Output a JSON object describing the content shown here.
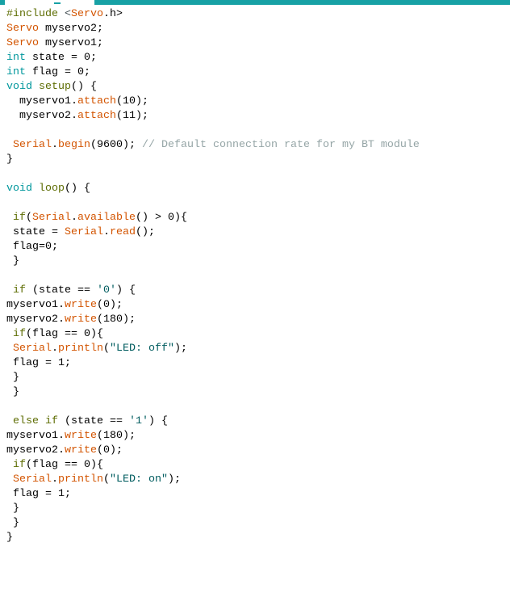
{
  "colors": {
    "tab_bar": "#17A1A5",
    "keyword": "#D35400",
    "type": "#00979C",
    "function": "#5E6D03",
    "string": "#005C5F",
    "comment": "#95A5A6"
  },
  "code": {
    "lines": [
      [
        [
          "#include ",
          "pp"
        ],
        [
          "<",
          "op"
        ],
        [
          "Servo",
          "kw"
        ],
        [
          ".h>",
          "plain"
        ]
      ],
      [
        [
          "Servo",
          "kw"
        ],
        [
          " myservo2;",
          "plain"
        ]
      ],
      [
        [
          "Servo",
          "kw"
        ],
        [
          " myservo1;",
          "plain"
        ]
      ],
      [
        [
          "int",
          "type"
        ],
        [
          " state = 0;",
          "plain"
        ]
      ],
      [
        [
          "int",
          "type"
        ],
        [
          " flag = 0;",
          "plain"
        ]
      ],
      [
        [
          "void",
          "type"
        ],
        [
          " ",
          "plain"
        ],
        [
          "setup",
          "fn"
        ],
        [
          "() {",
          "plain"
        ]
      ],
      [
        [
          "  myservo1.",
          "plain"
        ],
        [
          "attach",
          "kw"
        ],
        [
          "(10);",
          "plain"
        ]
      ],
      [
        [
          "  myservo2.",
          "plain"
        ],
        [
          "attach",
          "kw"
        ],
        [
          "(11);",
          "plain"
        ]
      ],
      [],
      [
        [
          " ",
          "plain"
        ],
        [
          "Serial",
          "kw"
        ],
        [
          ".",
          "plain"
        ],
        [
          "begin",
          "kw"
        ],
        [
          "(9600); ",
          "plain"
        ],
        [
          "// Default connection rate for my BT module",
          "cmt"
        ]
      ],
      [
        [
          "}",
          "plain"
        ]
      ],
      [],
      [
        [
          "void",
          "type"
        ],
        [
          " ",
          "plain"
        ],
        [
          "loop",
          "fn"
        ],
        [
          "() {",
          "plain"
        ]
      ],
      [],
      [
        [
          " ",
          "plain"
        ],
        [
          "if",
          "fn"
        ],
        [
          "(",
          "plain"
        ],
        [
          "Serial",
          "kw"
        ],
        [
          ".",
          "plain"
        ],
        [
          "available",
          "kw"
        ],
        [
          "() > 0){",
          "plain"
        ]
      ],
      [
        [
          " state = ",
          "plain"
        ],
        [
          "Serial",
          "kw"
        ],
        [
          ".",
          "plain"
        ],
        [
          "read",
          "kw"
        ],
        [
          "();",
          "plain"
        ]
      ],
      [
        [
          " flag=0;",
          "plain"
        ]
      ],
      [
        [
          " }",
          "plain"
        ]
      ],
      [],
      [
        [
          " ",
          "plain"
        ],
        [
          "if",
          "fn"
        ],
        [
          " (state == ",
          "plain"
        ],
        [
          "'0'",
          "str"
        ],
        [
          ") {",
          "plain"
        ]
      ],
      [
        [
          "myservo1.",
          "plain"
        ],
        [
          "write",
          "kw"
        ],
        [
          "(0);",
          "plain"
        ]
      ],
      [
        [
          "myservo2.",
          "plain"
        ],
        [
          "write",
          "kw"
        ],
        [
          "(180);",
          "plain"
        ]
      ],
      [
        [
          " ",
          "plain"
        ],
        [
          "if",
          "fn"
        ],
        [
          "(flag == 0){",
          "plain"
        ]
      ],
      [
        [
          " ",
          "plain"
        ],
        [
          "Serial",
          "kw"
        ],
        [
          ".",
          "plain"
        ],
        [
          "println",
          "kw"
        ],
        [
          "(",
          "plain"
        ],
        [
          "\"LED: off\"",
          "str"
        ],
        [
          ");",
          "plain"
        ]
      ],
      [
        [
          " flag = 1;",
          "plain"
        ]
      ],
      [
        [
          " }",
          "plain"
        ]
      ],
      [
        [
          " }",
          "plain"
        ]
      ],
      [],
      [
        [
          " ",
          "plain"
        ],
        [
          "else",
          "fn"
        ],
        [
          " ",
          "plain"
        ],
        [
          "if",
          "fn"
        ],
        [
          " (state == ",
          "plain"
        ],
        [
          "'1'",
          "str"
        ],
        [
          ") {",
          "plain"
        ]
      ],
      [
        [
          "myservo1.",
          "plain"
        ],
        [
          "write",
          "kw"
        ],
        [
          "(180);",
          "plain"
        ]
      ],
      [
        [
          "myservo2.",
          "plain"
        ],
        [
          "write",
          "kw"
        ],
        [
          "(0);",
          "plain"
        ]
      ],
      [
        [
          " ",
          "plain"
        ],
        [
          "if",
          "fn"
        ],
        [
          "(flag == 0){",
          "plain"
        ]
      ],
      [
        [
          " ",
          "plain"
        ],
        [
          "Serial",
          "kw"
        ],
        [
          ".",
          "plain"
        ],
        [
          "println",
          "kw"
        ],
        [
          "(",
          "plain"
        ],
        [
          "\"LED: on\"",
          "str"
        ],
        [
          ");",
          "plain"
        ]
      ],
      [
        [
          " flag = 1;",
          "plain"
        ]
      ],
      [
        [
          " }",
          "plain"
        ]
      ],
      [
        [
          " }",
          "plain"
        ]
      ],
      [
        [
          "}",
          "plain"
        ]
      ]
    ]
  }
}
